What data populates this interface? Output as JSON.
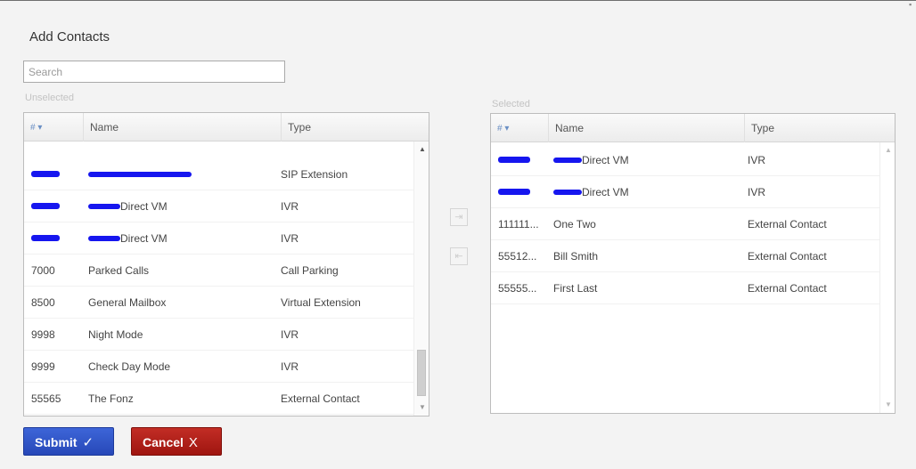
{
  "dialog": {
    "title": "Add Contacts",
    "search": {
      "placeholder": "Search",
      "value": ""
    },
    "unselected_label": "Unselected",
    "selected_label": "Selected",
    "submit": {
      "label": "Submit",
      "glyph": "✓"
    },
    "cancel": {
      "label": "Cancel",
      "glyph": "X"
    }
  },
  "columns": {
    "num": "# ▾",
    "name": "Name",
    "type": "Type"
  },
  "unselected_rows": [
    {
      "num": "",
      "name": "",
      "type": "SIP Extension",
      "redact_num": true,
      "redact_name": true
    },
    {
      "num": "",
      "name": "Direct VM",
      "type": "IVR",
      "redact_num": true,
      "redact_name": true
    },
    {
      "num": "",
      "name": "Direct VM",
      "type": "IVR",
      "redact_num": true,
      "redact_name": true
    },
    {
      "num": "7000",
      "name": "Parked Calls",
      "type": "Call Parking"
    },
    {
      "num": "8500",
      "name": "General Mailbox",
      "type": "Virtual Extension"
    },
    {
      "num": "9998",
      "name": "Night Mode",
      "type": "IVR"
    },
    {
      "num": "9999",
      "name": "Check Day Mode",
      "type": "IVR"
    },
    {
      "num": "55565",
      "name": "The Fonz",
      "type": "External Contact"
    }
  ],
  "selected_rows": [
    {
      "num": "",
      "name": "Direct VM",
      "type": "IVR",
      "redact_num": true,
      "redact_name": true
    },
    {
      "num": "",
      "name": "Direct VM",
      "type": "IVR",
      "redact_num": true,
      "redact_name": true
    },
    {
      "num": "111111...",
      "name": "One Two",
      "type": "External Contact"
    },
    {
      "num": "55512...",
      "name": "Bill Smith",
      "type": "External Contact"
    },
    {
      "num": "55555...",
      "name": "First Last",
      "type": "External Contact"
    }
  ],
  "colors": {
    "redaction": "#1616ef",
    "submit": "#2f56c8",
    "cancel": "#b01e18"
  }
}
